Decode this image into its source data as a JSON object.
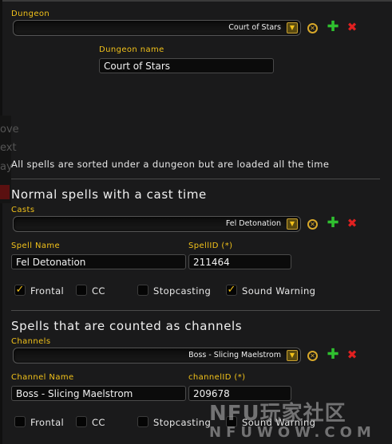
{
  "dungeon": {
    "label": "Dungeon",
    "selected": "Court of Stars",
    "name_label": "Dungeon name",
    "name_value": "Court of Stars"
  },
  "edge_fragments": [
    "ove",
    "ext",
    "ay"
  ],
  "info_text": "All spells are sorted under a dungeon but are loaded all the time",
  "casts": {
    "title": "Normal spells with a cast time",
    "label": "Casts",
    "selected": "Fel Detonation",
    "name_label": "Spell Name",
    "name_value": "Fel Detonation",
    "id_label": "SpellID (*)",
    "id_value": "211464",
    "options": [
      {
        "label": "Frontal",
        "checked": true
      },
      {
        "label": "CC",
        "checked": false
      },
      {
        "label": "Stopcasting",
        "checked": false
      },
      {
        "label": "Sound Warning",
        "checked": true
      }
    ]
  },
  "channels": {
    "title": "Spells that are counted as channels",
    "label": "Channels",
    "selected": "Boss - Slicing Maelstrom",
    "name_label": "Channel Name",
    "name_value": "Boss - Slicing Maelstrom",
    "id_label": "channelID (*)",
    "id_value": "209678",
    "options": [
      {
        "label": "Frontal",
        "checked": false
      },
      {
        "label": "CC",
        "checked": false
      },
      {
        "label": "Stopcasting",
        "checked": false
      },
      {
        "label": "Sound Warning",
        "checked": false
      }
    ]
  },
  "icons": {
    "dropdown_arrow": "dropdown-arrow-icon",
    "reset": "reset-icon",
    "add": "plus-icon",
    "delete": "close-icon",
    "check": "checkmark-icon"
  },
  "colors": {
    "label": "#f2c21a",
    "add": "#2fc02f",
    "delete": "#e02020",
    "background": "#1a1a1b"
  },
  "watermark": {
    "logo": "NFU玩家社区",
    "url": "NFUWOW.COM"
  }
}
